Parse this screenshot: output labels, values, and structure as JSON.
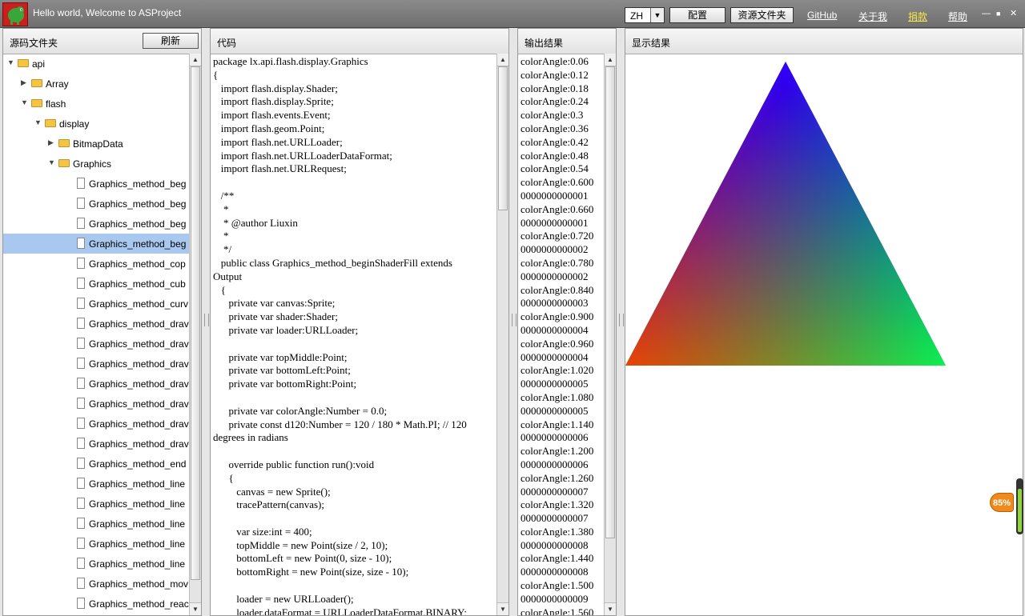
{
  "titlebar": {
    "title": "Hello world, Welcome to ASProject",
    "lang": "ZH",
    "config_label": "配置",
    "resources_label": "资源文件夹",
    "links": [
      {
        "label": "GitHub",
        "color": "#ffffff"
      },
      {
        "label": "关于我",
        "color": "#ffffff"
      },
      {
        "label": "捐款",
        "color": "#f7e84b"
      },
      {
        "label": "帮助",
        "color": "#ffffff"
      }
    ],
    "window_controls": [
      "—",
      "■",
      "✕"
    ]
  },
  "source_panel": {
    "title": "源码文件夹",
    "refresh_label": "刷新",
    "tree": [
      {
        "label": "api",
        "type": "folder",
        "depth": 0,
        "expanded": true
      },
      {
        "label": "Array",
        "type": "folder",
        "depth": 1,
        "expanded": false
      },
      {
        "label": "flash",
        "type": "folder",
        "depth": 1,
        "expanded": true
      },
      {
        "label": "display",
        "type": "folder",
        "depth": 2,
        "expanded": true
      },
      {
        "label": "BitmapData",
        "type": "folder",
        "depth": 3,
        "expanded": false
      },
      {
        "label": "Graphics",
        "type": "folder",
        "depth": 3,
        "expanded": true
      },
      {
        "label": "Graphics_method_beg",
        "type": "file",
        "depth": 4
      },
      {
        "label": "Graphics_method_beg",
        "type": "file",
        "depth": 4
      },
      {
        "label": "Graphics_method_beg",
        "type": "file",
        "depth": 4
      },
      {
        "label": "Graphics_method_beg",
        "type": "file",
        "depth": 4,
        "selected": true
      },
      {
        "label": "Graphics_method_cop",
        "type": "file",
        "depth": 4
      },
      {
        "label": "Graphics_method_cub",
        "type": "file",
        "depth": 4
      },
      {
        "label": "Graphics_method_curv",
        "type": "file",
        "depth": 4
      },
      {
        "label": "Graphics_method_drav",
        "type": "file",
        "depth": 4
      },
      {
        "label": "Graphics_method_drav",
        "type": "file",
        "depth": 4
      },
      {
        "label": "Graphics_method_drav",
        "type": "file",
        "depth": 4
      },
      {
        "label": "Graphics_method_drav",
        "type": "file",
        "depth": 4
      },
      {
        "label": "Graphics_method_drav",
        "type": "file",
        "depth": 4
      },
      {
        "label": "Graphics_method_drav",
        "type": "file",
        "depth": 4
      },
      {
        "label": "Graphics_method_drav",
        "type": "file",
        "depth": 4
      },
      {
        "label": "Graphics_method_end",
        "type": "file",
        "depth": 4
      },
      {
        "label": "Graphics_method_line",
        "type": "file",
        "depth": 4
      },
      {
        "label": "Graphics_method_line",
        "type": "file",
        "depth": 4
      },
      {
        "label": "Graphics_method_line",
        "type": "file",
        "depth": 4
      },
      {
        "label": "Graphics_method_line",
        "type": "file",
        "depth": 4
      },
      {
        "label": "Graphics_method_line",
        "type": "file",
        "depth": 4
      },
      {
        "label": "Graphics_method_mov",
        "type": "file",
        "depth": 4
      },
      {
        "label": "Graphics_method_reac",
        "type": "file",
        "depth": 4
      }
    ]
  },
  "code_panel": {
    "title": "代码",
    "lines": [
      "package lx.api.flash.display.Graphics",
      "{",
      "   import flash.display.Shader;",
      "   import flash.display.Sprite;",
      "   import flash.events.Event;",
      "   import flash.geom.Point;",
      "   import flash.net.URLLoader;",
      "   import flash.net.URLLoaderDataFormat;",
      "   import flash.net.URLRequest;",
      "",
      "   /**",
      "    *",
      "    * @author Liuxin",
      "    *",
      "    */",
      "   public class Graphics_method_beginShaderFill extends",
      "Output",
      "   {",
      "      private var canvas:Sprite;",
      "      private var shader:Shader;",
      "      private var loader:URLLoader;",
      "",
      "      private var topMiddle:Point;",
      "      private var bottomLeft:Point;",
      "      private var bottomRight:Point;",
      "",
      "      private var colorAngle:Number = 0.0;",
      "      private const d120:Number = 120 / 180 * Math.PI; // 120",
      "degrees in radians",
      "",
      "      override public function run():void",
      "      {",
      "         canvas = new Sprite();",
      "         tracePattern(canvas);",
      "",
      "         var size:int = 400;",
      "         topMiddle = new Point(size / 2, 10);",
      "         bottomLeft = new Point(0, size - 10);",
      "         bottomRight = new Point(size, size - 10);",
      "",
      "         loader = new URLLoader();",
      "         loader.dataFormat = URLLoaderDataFormat.BINARY;"
    ]
  },
  "output_panel": {
    "title": "输出结果",
    "lines": [
      "colorAngle:0.06",
      "colorAngle:0.12",
      "colorAngle:0.18",
      "colorAngle:0.24",
      "colorAngle:0.3",
      "colorAngle:0.36",
      "colorAngle:0.42",
      "colorAngle:0.48",
      "colorAngle:0.54",
      "colorAngle:0.600",
      "0000000000001",
      "colorAngle:0.660",
      "0000000000001",
      "colorAngle:0.720",
      "0000000000002",
      "colorAngle:0.780",
      "0000000000002",
      "colorAngle:0.840",
      "0000000000003",
      "colorAngle:0.900",
      "0000000000004",
      "colorAngle:0.960",
      "0000000000004",
      "colorAngle:1.020",
      "0000000000005",
      "colorAngle:1.080",
      "0000000000005",
      "colorAngle:1.140",
      "0000000000006",
      "colorAngle:1.200",
      "0000000000006",
      "colorAngle:1.260",
      "0000000000007",
      "colorAngle:1.320",
      "0000000000007",
      "colorAngle:1.380",
      "0000000000008",
      "colorAngle:1.440",
      "0000000000008",
      "colorAngle:1.500",
      "0000000000009",
      "colorAngle:1.560"
    ]
  },
  "display_panel": {
    "title": "显示结果",
    "triangle_colors": {
      "top": "#3300ff",
      "left": "#e83a00",
      "right": "#00f050"
    }
  },
  "zoom": {
    "label": "85%",
    "value": 0.85
  }
}
